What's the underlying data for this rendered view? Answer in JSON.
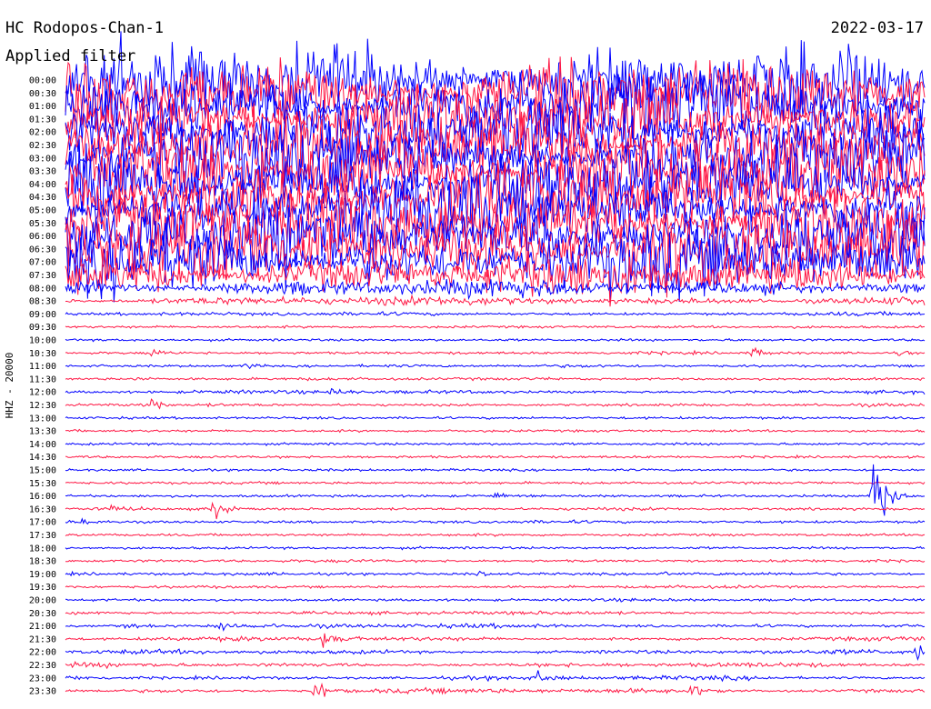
{
  "header": {
    "station_title": "HC Rodopos-Chan-1",
    "filter_note": "Applied filter",
    "date": "2022-03-17"
  },
  "chart_data": {
    "type": "helicorder",
    "ylabel": "HHZ - 20000",
    "time_labels": [
      "00:00",
      "00:30",
      "01:00",
      "01:30",
      "02:00",
      "02:30",
      "03:00",
      "03:30",
      "04:00",
      "04:30",
      "05:00",
      "05:30",
      "06:00",
      "06:30",
      "07:00",
      "07:30",
      "08:00",
      "08:30",
      "09:00",
      "09:30",
      "10:00",
      "10:30",
      "11:00",
      "11:30",
      "12:00",
      "12:30",
      "13:00",
      "13:30",
      "14:00",
      "14:30",
      "15:00",
      "15:30",
      "16:00",
      "16:30",
      "17:00",
      "17:30",
      "18:00",
      "18:30",
      "19:00",
      "19:30",
      "20:00",
      "20:30",
      "21:00",
      "21:30",
      "22:00",
      "22:30",
      "23:00",
      "23:30"
    ],
    "colors": {
      "even_rows": "#0000ff",
      "odd_rows": "#ff1744"
    },
    "noise_amplitude": [
      1.0,
      1.0,
      1.0,
      1.0,
      1.0,
      1.0,
      1.0,
      1.0,
      1.0,
      1.0,
      1.0,
      1.0,
      1.0,
      1.0,
      0.9,
      0.6,
      0.25,
      0.12,
      0.05,
      0.03,
      0.03,
      0.04,
      0.04,
      0.04,
      0.05,
      0.04,
      0.03,
      0.03,
      0.03,
      0.03,
      0.03,
      0.03,
      0.03,
      0.04,
      0.04,
      0.03,
      0.03,
      0.04,
      0.04,
      0.04,
      0.04,
      0.05,
      0.06,
      0.06,
      0.06,
      0.06,
      0.06,
      0.07
    ],
    "events": [
      {
        "row": 21,
        "x": 0.1,
        "amp": 0.3
      },
      {
        "row": 21,
        "x": 0.8,
        "amp": 0.6
      },
      {
        "row": 21,
        "x": 0.97,
        "amp": 0.3
      },
      {
        "row": 22,
        "x": 0.21,
        "amp": 0.3
      },
      {
        "row": 23,
        "x": 0.08,
        "amp": 0.3
      },
      {
        "row": 24,
        "x": 0.31,
        "amp": 0.5
      },
      {
        "row": 25,
        "x": 0.1,
        "amp": 0.7
      },
      {
        "row": 32,
        "x": 0.5,
        "amp": 0.3
      },
      {
        "row": 32,
        "x": 0.94,
        "amp": 4.5
      },
      {
        "row": 33,
        "x": 0.05,
        "amp": 0.5
      },
      {
        "row": 33,
        "x": 0.17,
        "amp": 1.2
      },
      {
        "row": 34,
        "x": 0.02,
        "amp": 0.3
      },
      {
        "row": 38,
        "x": 0.48,
        "amp": 0.3
      },
      {
        "row": 38,
        "x": 0.69,
        "amp": 0.3
      },
      {
        "row": 42,
        "x": 0.07,
        "amp": 0.4
      },
      {
        "row": 42,
        "x": 0.18,
        "amp": 0.5
      },
      {
        "row": 43,
        "x": 0.3,
        "amp": 0.8
      },
      {
        "row": 44,
        "x": 0.99,
        "amp": 0.9
      },
      {
        "row": 46,
        "x": 0.55,
        "amp": 0.4
      },
      {
        "row": 47,
        "x": 0.29,
        "amp": 1.0
      },
      {
        "row": 47,
        "x": 0.73,
        "amp": 0.8
      }
    ]
  }
}
